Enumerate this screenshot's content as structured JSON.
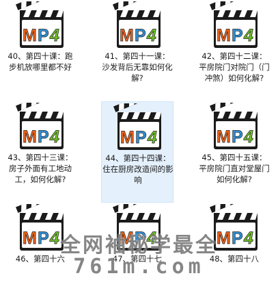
{
  "files": [
    {
      "caption": "40、第四十课：跑步机放哪里都不好",
      "icon": "mp4-clapperboard-icon",
      "badge": "MP4"
    },
    {
      "caption": "41、第四十一课：沙发背后无靠如何化解?",
      "icon": "mp4-clapperboard-icon",
      "badge": "MP4"
    },
    {
      "caption": "42、第四十二课：平房院门对院门（门冲煞）如何化解?",
      "icon": "mp4-clapperboard-icon",
      "badge": "MP4"
    },
    {
      "caption": "43、第四十三课：房子外面有工地动工，如何化解?",
      "icon": "mp4-clapperboard-icon",
      "badge": "MP4"
    },
    {
      "caption": "44、第四十四课：住在厨房改造间的影响",
      "icon": "mp4-clapperboard-icon",
      "badge": "MP4"
    },
    {
      "caption": "45、第四十五课：平房院门直对堂屋门如何化解?",
      "icon": "mp4-clapperboard-icon",
      "badge": "MP4"
    },
    {
      "caption": "46、第四十六",
      "icon": "mp4-clapperboard-icon",
      "badge": "MP4"
    },
    {
      "caption": "47、第四十七",
      "icon": "mp4-clapperboard-icon",
      "badge": "MP4"
    },
    {
      "caption": "48、第四十八",
      "icon": "mp4-clapperboard-icon",
      "badge": "MP4"
    }
  ],
  "selected_index": 4,
  "watermark": {
    "line1": "全网袖秘学最全",
    "line2": "761m.com"
  },
  "colors": {
    "m": "#e8631c",
    "p": "#2f8fd6",
    "four": "#6fbf26",
    "selection": "#e4f0fb"
  }
}
